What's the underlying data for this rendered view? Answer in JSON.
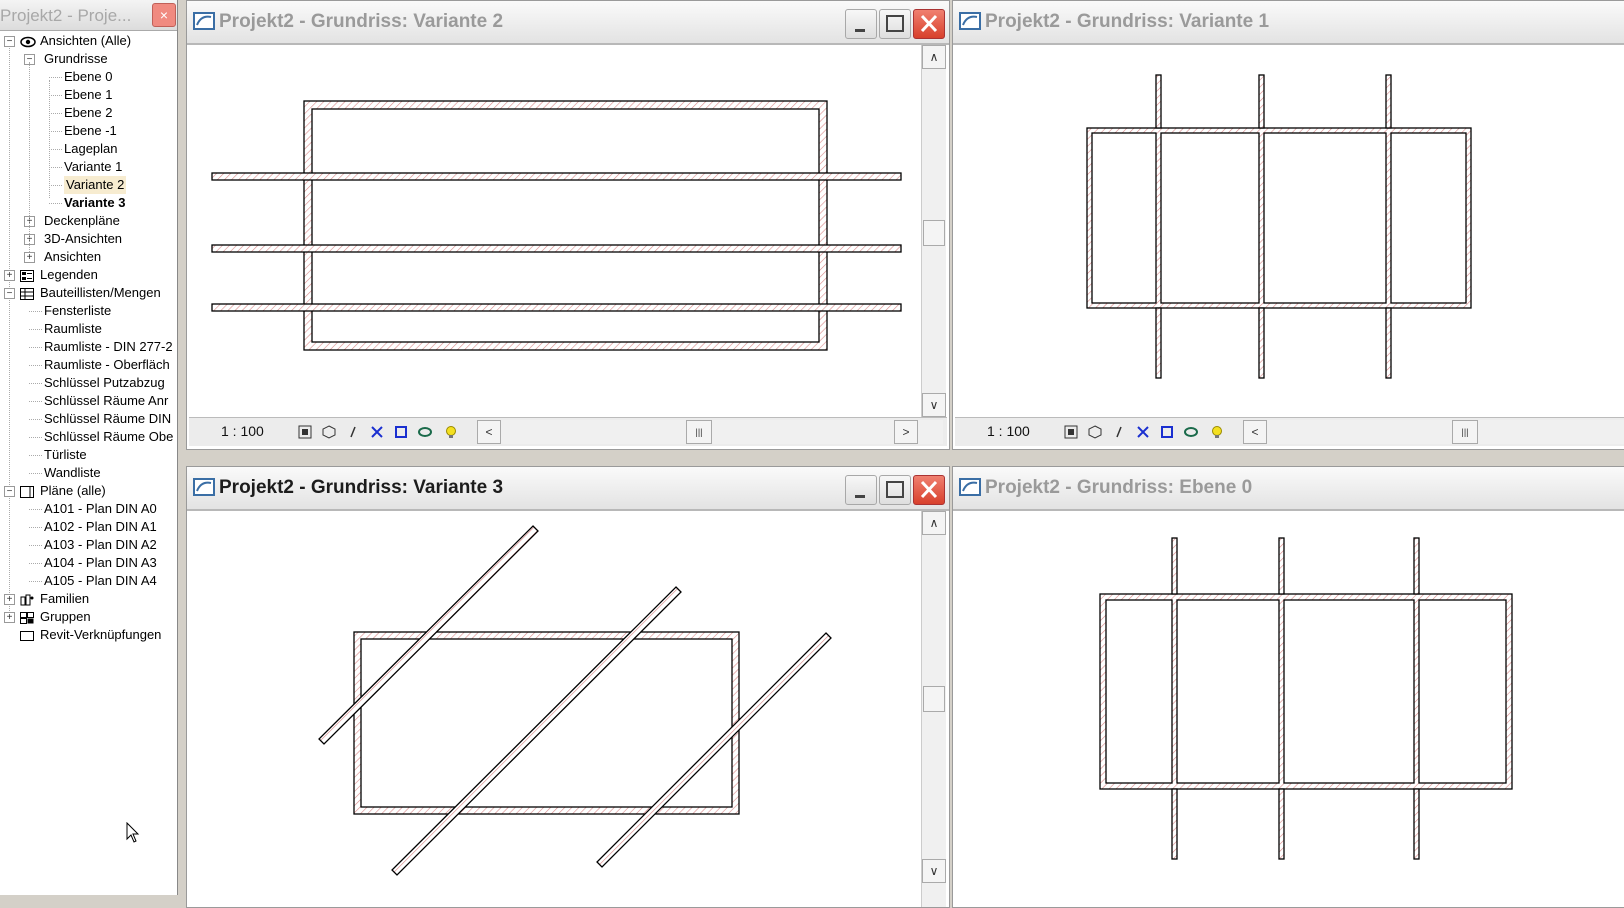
{
  "browser": {
    "title": "Projekt2 - Proje...",
    "close_label": "×",
    "items": [
      {
        "label": "Ansichten (Alle)",
        "level": 0,
        "expander": "−",
        "icon": "eye-icon"
      },
      {
        "label": "Grundrisse",
        "level": 1,
        "expander": "−"
      },
      {
        "label": "Ebene 0",
        "level": 2
      },
      {
        "label": "Ebene 1",
        "level": 2
      },
      {
        "label": "Ebene 2",
        "level": 2
      },
      {
        "label": "Ebene -1",
        "level": 2
      },
      {
        "label": "Lageplan",
        "level": 2
      },
      {
        "label": "Variante 1",
        "level": 2
      },
      {
        "label": "Variante 2",
        "level": 2,
        "state": "selected"
      },
      {
        "label": "Variante 3",
        "level": 2,
        "state": "bold"
      },
      {
        "label": "Deckenpläne",
        "level": 1,
        "expander": "+"
      },
      {
        "label": "3D-Ansichten",
        "level": 1,
        "expander": "+"
      },
      {
        "label": "Ansichten",
        "level": 1,
        "expander": "+"
      },
      {
        "label": "Legenden",
        "level": 0,
        "expander": "+",
        "icon": "legend-icon"
      },
      {
        "label": "Bauteillisten/Mengen",
        "level": 0,
        "expander": "−",
        "icon": "schedule-icon"
      },
      {
        "label": "Fensterliste",
        "level": 1
      },
      {
        "label": "Raumliste",
        "level": 1
      },
      {
        "label": "Raumliste - DIN 277-2",
        "level": 1
      },
      {
        "label": "Raumliste - Oberfläch",
        "level": 1
      },
      {
        "label": "Schlüssel Putzabzug",
        "level": 1
      },
      {
        "label": "Schlüssel Räume Anr",
        "level": 1
      },
      {
        "label": "Schlüssel Räume DIN",
        "level": 1
      },
      {
        "label": "Schlüssel Räume Obe",
        "level": 1
      },
      {
        "label": "Türliste",
        "level": 1
      },
      {
        "label": "Wandliste",
        "level": 1
      },
      {
        "label": "Pläne (alle)",
        "level": 0,
        "expander": "−",
        "icon": "sheet-icon"
      },
      {
        "label": "A101 - Plan DIN A0",
        "level": 1
      },
      {
        "label": "A102 - Plan DIN A1",
        "level": 1
      },
      {
        "label": "A103 - Plan DIN A2",
        "level": 1
      },
      {
        "label": "A104 - Plan DIN A3",
        "level": 1
      },
      {
        "label": "A105 - Plan DIN A4",
        "level": 1
      },
      {
        "label": "Familien",
        "level": 0,
        "expander": "+",
        "icon": "family-icon"
      },
      {
        "label": "Gruppen",
        "level": 0,
        "expander": "+",
        "icon": "group-icon"
      },
      {
        "label": "Revit-Verknüpfungen",
        "level": 0,
        "icon": "link-icon"
      }
    ]
  },
  "windows": {
    "variante2": {
      "title": "Projekt2 - Grundriss: Variante 2",
      "scale": "1 : 100"
    },
    "variante1": {
      "title": "Projekt2 - Grundriss: Variante 1",
      "scale": "1 : 100"
    },
    "variante3": {
      "title": "Projekt2 - Grundriss: Variante 3"
    },
    "ebene0": {
      "title": "Projekt2 - Grundriss: Ebene 0"
    }
  },
  "colors": {
    "wall_hatch": "#d98a8a",
    "wall_line": "#000000",
    "selected_bg": "#f7ecd0",
    "close_red": "#d8402c"
  },
  "scroll_arrows": {
    "up": "∧",
    "down": "∨",
    "left": "<",
    "right": ">",
    "grip": "|||"
  }
}
